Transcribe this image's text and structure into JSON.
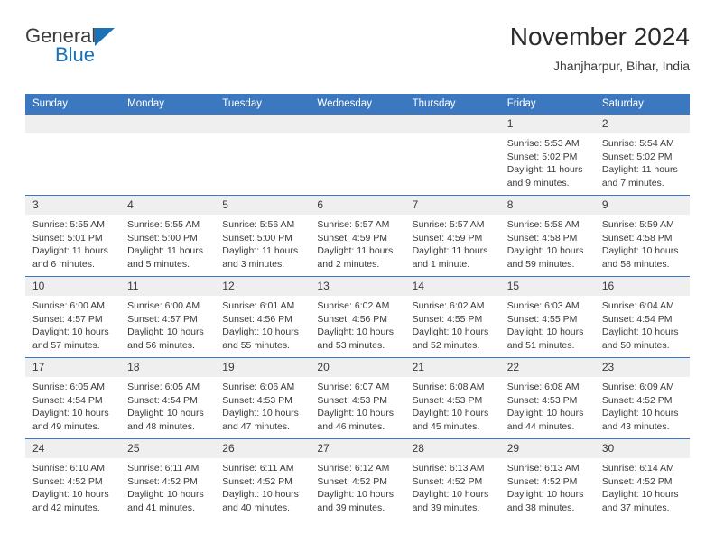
{
  "brand": {
    "name_top": "General",
    "name_bottom": "Blue",
    "accent_color": "#1a72b8"
  },
  "header": {
    "title": "November 2024",
    "subtitle": "Jhanjharpur, Bihar, India"
  },
  "theme": {
    "header_blue": "#3b78bf",
    "daynum_gray": "#efefef",
    "text": "#3a3a3a"
  },
  "weekday_headers": [
    "Sunday",
    "Monday",
    "Tuesday",
    "Wednesday",
    "Thursday",
    "Friday",
    "Saturday"
  ],
  "labels": {
    "sunrise_prefix": "Sunrise: ",
    "sunset_prefix": "Sunset: ",
    "daylight_prefix": "Daylight: "
  },
  "weeks": [
    [
      {
        "day": "",
        "sunrise": "",
        "sunset": "",
        "daylight": ""
      },
      {
        "day": "",
        "sunrise": "",
        "sunset": "",
        "daylight": ""
      },
      {
        "day": "",
        "sunrise": "",
        "sunset": "",
        "daylight": ""
      },
      {
        "day": "",
        "sunrise": "",
        "sunset": "",
        "daylight": ""
      },
      {
        "day": "",
        "sunrise": "",
        "sunset": "",
        "daylight": ""
      },
      {
        "day": "1",
        "sunrise": "Sunrise: 5:53 AM",
        "sunset": "Sunset: 5:02 PM",
        "daylight": "Daylight: 11 hours and 9 minutes."
      },
      {
        "day": "2",
        "sunrise": "Sunrise: 5:54 AM",
        "sunset": "Sunset: 5:02 PM",
        "daylight": "Daylight: 11 hours and 7 minutes."
      }
    ],
    [
      {
        "day": "3",
        "sunrise": "Sunrise: 5:55 AM",
        "sunset": "Sunset: 5:01 PM",
        "daylight": "Daylight: 11 hours and 6 minutes."
      },
      {
        "day": "4",
        "sunrise": "Sunrise: 5:55 AM",
        "sunset": "Sunset: 5:00 PM",
        "daylight": "Daylight: 11 hours and 5 minutes."
      },
      {
        "day": "5",
        "sunrise": "Sunrise: 5:56 AM",
        "sunset": "Sunset: 5:00 PM",
        "daylight": "Daylight: 11 hours and 3 minutes."
      },
      {
        "day": "6",
        "sunrise": "Sunrise: 5:57 AM",
        "sunset": "Sunset: 4:59 PM",
        "daylight": "Daylight: 11 hours and 2 minutes."
      },
      {
        "day": "7",
        "sunrise": "Sunrise: 5:57 AM",
        "sunset": "Sunset: 4:59 PM",
        "daylight": "Daylight: 11 hours and 1 minute."
      },
      {
        "day": "8",
        "sunrise": "Sunrise: 5:58 AM",
        "sunset": "Sunset: 4:58 PM",
        "daylight": "Daylight: 10 hours and 59 minutes."
      },
      {
        "day": "9",
        "sunrise": "Sunrise: 5:59 AM",
        "sunset": "Sunset: 4:58 PM",
        "daylight": "Daylight: 10 hours and 58 minutes."
      }
    ],
    [
      {
        "day": "10",
        "sunrise": "Sunrise: 6:00 AM",
        "sunset": "Sunset: 4:57 PM",
        "daylight": "Daylight: 10 hours and 57 minutes."
      },
      {
        "day": "11",
        "sunrise": "Sunrise: 6:00 AM",
        "sunset": "Sunset: 4:57 PM",
        "daylight": "Daylight: 10 hours and 56 minutes."
      },
      {
        "day": "12",
        "sunrise": "Sunrise: 6:01 AM",
        "sunset": "Sunset: 4:56 PM",
        "daylight": "Daylight: 10 hours and 55 minutes."
      },
      {
        "day": "13",
        "sunrise": "Sunrise: 6:02 AM",
        "sunset": "Sunset: 4:56 PM",
        "daylight": "Daylight: 10 hours and 53 minutes."
      },
      {
        "day": "14",
        "sunrise": "Sunrise: 6:02 AM",
        "sunset": "Sunset: 4:55 PM",
        "daylight": "Daylight: 10 hours and 52 minutes."
      },
      {
        "day": "15",
        "sunrise": "Sunrise: 6:03 AM",
        "sunset": "Sunset: 4:55 PM",
        "daylight": "Daylight: 10 hours and 51 minutes."
      },
      {
        "day": "16",
        "sunrise": "Sunrise: 6:04 AM",
        "sunset": "Sunset: 4:54 PM",
        "daylight": "Daylight: 10 hours and 50 minutes."
      }
    ],
    [
      {
        "day": "17",
        "sunrise": "Sunrise: 6:05 AM",
        "sunset": "Sunset: 4:54 PM",
        "daylight": "Daylight: 10 hours and 49 minutes."
      },
      {
        "day": "18",
        "sunrise": "Sunrise: 6:05 AM",
        "sunset": "Sunset: 4:54 PM",
        "daylight": "Daylight: 10 hours and 48 minutes."
      },
      {
        "day": "19",
        "sunrise": "Sunrise: 6:06 AM",
        "sunset": "Sunset: 4:53 PM",
        "daylight": "Daylight: 10 hours and 47 minutes."
      },
      {
        "day": "20",
        "sunrise": "Sunrise: 6:07 AM",
        "sunset": "Sunset: 4:53 PM",
        "daylight": "Daylight: 10 hours and 46 minutes."
      },
      {
        "day": "21",
        "sunrise": "Sunrise: 6:08 AM",
        "sunset": "Sunset: 4:53 PM",
        "daylight": "Daylight: 10 hours and 45 minutes."
      },
      {
        "day": "22",
        "sunrise": "Sunrise: 6:08 AM",
        "sunset": "Sunset: 4:53 PM",
        "daylight": "Daylight: 10 hours and 44 minutes."
      },
      {
        "day": "23",
        "sunrise": "Sunrise: 6:09 AM",
        "sunset": "Sunset: 4:52 PM",
        "daylight": "Daylight: 10 hours and 43 minutes."
      }
    ],
    [
      {
        "day": "24",
        "sunrise": "Sunrise: 6:10 AM",
        "sunset": "Sunset: 4:52 PM",
        "daylight": "Daylight: 10 hours and 42 minutes."
      },
      {
        "day": "25",
        "sunrise": "Sunrise: 6:11 AM",
        "sunset": "Sunset: 4:52 PM",
        "daylight": "Daylight: 10 hours and 41 minutes."
      },
      {
        "day": "26",
        "sunrise": "Sunrise: 6:11 AM",
        "sunset": "Sunset: 4:52 PM",
        "daylight": "Daylight: 10 hours and 40 minutes."
      },
      {
        "day": "27",
        "sunrise": "Sunrise: 6:12 AM",
        "sunset": "Sunset: 4:52 PM",
        "daylight": "Daylight: 10 hours and 39 minutes."
      },
      {
        "day": "28",
        "sunrise": "Sunrise: 6:13 AM",
        "sunset": "Sunset: 4:52 PM",
        "daylight": "Daylight: 10 hours and 39 minutes."
      },
      {
        "day": "29",
        "sunrise": "Sunrise: 6:13 AM",
        "sunset": "Sunset: 4:52 PM",
        "daylight": "Daylight: 10 hours and 38 minutes."
      },
      {
        "day": "30",
        "sunrise": "Sunrise: 6:14 AM",
        "sunset": "Sunset: 4:52 PM",
        "daylight": "Daylight: 10 hours and 37 minutes."
      }
    ]
  ]
}
